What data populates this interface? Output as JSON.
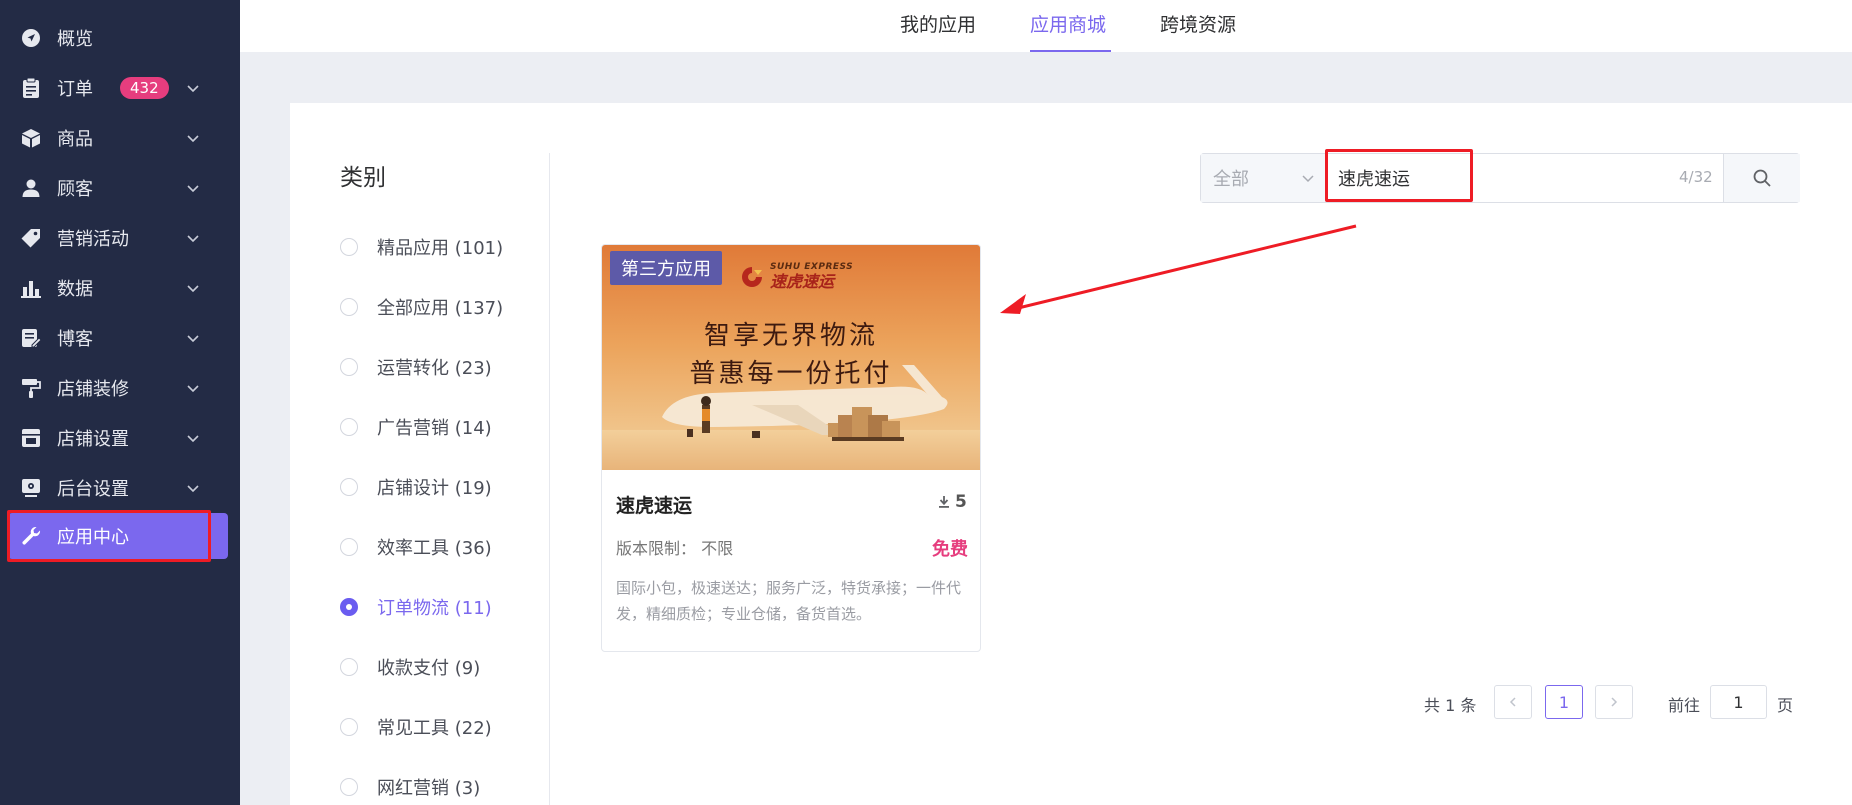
{
  "sidebar": {
    "items": [
      {
        "label": "概览",
        "icon": "navigation-arrow-icon",
        "has_chevron": false
      },
      {
        "label": "订单",
        "icon": "clipboard-icon",
        "has_chevron": true,
        "badge": "432"
      },
      {
        "label": "商品",
        "icon": "box-icon",
        "has_chevron": true
      },
      {
        "label": "顾客",
        "icon": "user-icon",
        "has_chevron": true
      },
      {
        "label": "营销活动",
        "icon": "tag-icon",
        "has_chevron": true
      },
      {
        "label": "数据",
        "icon": "bar-chart-icon",
        "has_chevron": true
      },
      {
        "label": "博客",
        "icon": "edit-document-icon",
        "has_chevron": true
      },
      {
        "label": "店铺装修",
        "icon": "paint-roller-icon",
        "has_chevron": true
      },
      {
        "label": "店铺设置",
        "icon": "store-icon",
        "has_chevron": true
      },
      {
        "label": "后台设置",
        "icon": "settings-screen-icon",
        "has_chevron": true
      },
      {
        "label": "应用中心",
        "icon": "wrench-icon",
        "has_chevron": false,
        "active": true
      }
    ]
  },
  "tabs": [
    {
      "label": "我的应用"
    },
    {
      "label": "应用商城",
      "active": true
    },
    {
      "label": "跨境资源"
    }
  ],
  "categories": {
    "title": "类别",
    "items": [
      {
        "label": "精品应用 (101)"
      },
      {
        "label": "全部应用 (137)"
      },
      {
        "label": "运营转化 (23)"
      },
      {
        "label": "广告营销 (14)"
      },
      {
        "label": "店铺设计 (19)"
      },
      {
        "label": "效率工具 (36)"
      },
      {
        "label": "订单物流 (11)",
        "checked": true
      },
      {
        "label": "收款支付 (9)"
      },
      {
        "label": "常见工具 (22)"
      },
      {
        "label": "网红营销 (3)"
      }
    ]
  },
  "search": {
    "select_value": "全部",
    "query": "速虎速运",
    "count": "4/32"
  },
  "app_card": {
    "tag": "第三方应用",
    "logo_en": "SUHU EXPRESS",
    "logo_cn": "速虎速运",
    "slogan_line1": "智享无界物流",
    "slogan_line2": "普惠每一份托付",
    "title": "速虎速运",
    "downloads": "5",
    "limit_label": "版本限制：",
    "limit_value": "不限",
    "price": "免费",
    "description": "国际小包，极速送达；服务广泛，特货承接；一件代发，精细质检；专业仓储，备货首选。"
  },
  "pagination": {
    "total": "共 1 条",
    "current_page": "1",
    "goto_label": "前往",
    "goto_value": "1",
    "page_suffix": "页"
  },
  "colors": {
    "sidebar_bg": "#232b45",
    "accent": "#7b68ee",
    "badge": "#e63d7e",
    "annotation_red": "#ee1c25"
  }
}
